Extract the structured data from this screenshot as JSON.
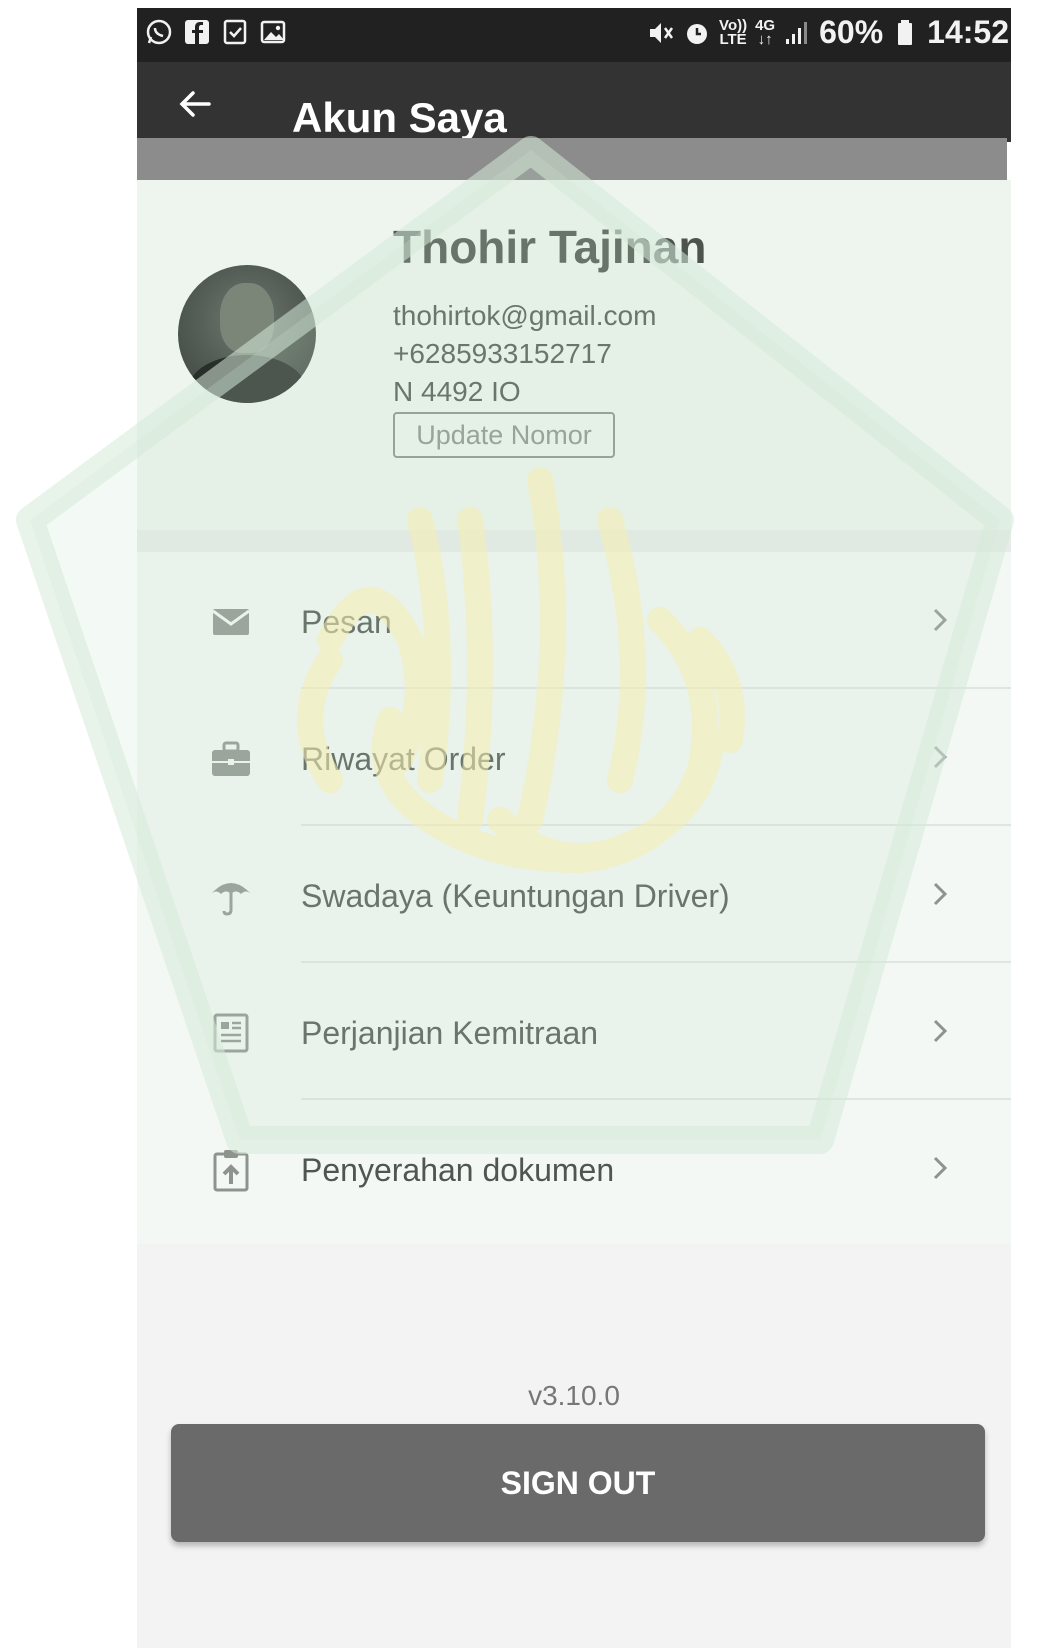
{
  "status_bar": {
    "left_icons": [
      "whatsapp-icon",
      "facebook-icon",
      "checkbox-icon",
      "image-icon"
    ],
    "right_icons": [
      "mute-icon",
      "alarm-icon",
      "volte-icon",
      "4g-icon",
      "signal-icon",
      "battery-icon"
    ],
    "volte_top": "Vo))",
    "volte_bottom": "LTE",
    "network_top": "4G",
    "network_bottom": "↓↑",
    "battery": "60%",
    "time": "14:52"
  },
  "app_bar": {
    "back_icon": "arrow-left-icon",
    "title": "Akun Saya"
  },
  "profile": {
    "name": "Thohir Tajinan",
    "email": "thohirtok@gmail.com",
    "phone": "+6285933152717",
    "plate": "N 4492 IO",
    "update_button": "Update Nomor"
  },
  "menu": {
    "items": [
      {
        "label": "Pesan",
        "icon": "envelope-icon"
      },
      {
        "label": "Riwayat Order",
        "icon": "briefcase-icon"
      },
      {
        "label": "Swadaya (Keuntungan Driver)",
        "icon": "umbrella-icon"
      },
      {
        "label": "Perjanjian Kemitraan",
        "icon": "document-icon"
      },
      {
        "label": "Penyerahan dokumen",
        "icon": "clipboard-upload-icon"
      }
    ]
  },
  "footer": {
    "version": "v3.10.0",
    "sign_out": "SIGN OUT"
  },
  "colors": {
    "status_bar": "#212121",
    "app_bar": "#333333",
    "profile_bg": "#eef5ef",
    "watermark_green": "#c8e4cc",
    "watermark_gold": "#f5edb0",
    "sign_out_button": "#6a6a6a"
  }
}
